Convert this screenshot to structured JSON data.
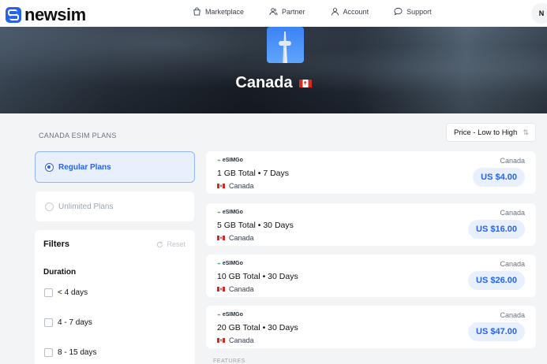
{
  "brand": {
    "name": "newsim"
  },
  "nav": {
    "items": [
      {
        "label": "Marketplace",
        "icon": "shopping-bag-icon"
      },
      {
        "label": "Partner",
        "icon": "users-icon"
      },
      {
        "label": "Account",
        "icon": "user-icon"
      },
      {
        "label": "Support",
        "icon": "chat-bubble-icon"
      }
    ],
    "avatar_initial": "N"
  },
  "hero": {
    "country": "Canada"
  },
  "plans_section": {
    "label": "CANADA ESIM PLANS"
  },
  "plan_types": [
    {
      "label": "Regular Plans",
      "selected": true
    },
    {
      "label": "Unlimited Plans",
      "selected": false
    }
  ],
  "filters": {
    "title": "Filters",
    "reset_label": "Reset",
    "duration_title": "Duration",
    "duration_options": [
      "< 4 days",
      "4 - 7 days",
      "8 - 15 days"
    ]
  },
  "sort": {
    "label": "Price - Low to High"
  },
  "cards": [
    {
      "provider": "eSIMGo",
      "name": "1 GB Total • 7 Days",
      "country": "Canada",
      "region": "Canada",
      "price": "US $4.00"
    },
    {
      "provider": "eSIMGo",
      "name": "5 GB Total • 30 Days",
      "country": "Canada",
      "region": "Canada",
      "price": "US $16.00"
    },
    {
      "provider": "eSIMGo",
      "name": "10 GB Total • 30 Days",
      "country": "Canada",
      "region": "Canada",
      "price": "US $26.00"
    },
    {
      "provider": "eSIMGo",
      "name": "20 GB Total • 30 Days",
      "country": "Canada",
      "region": "Canada",
      "price": "US $47.00"
    }
  ],
  "features_label": "FEATURES",
  "colors": {
    "accent": "#2563eb",
    "accent_bg": "#e8f0fe",
    "provider_green": "#16a34a"
  }
}
